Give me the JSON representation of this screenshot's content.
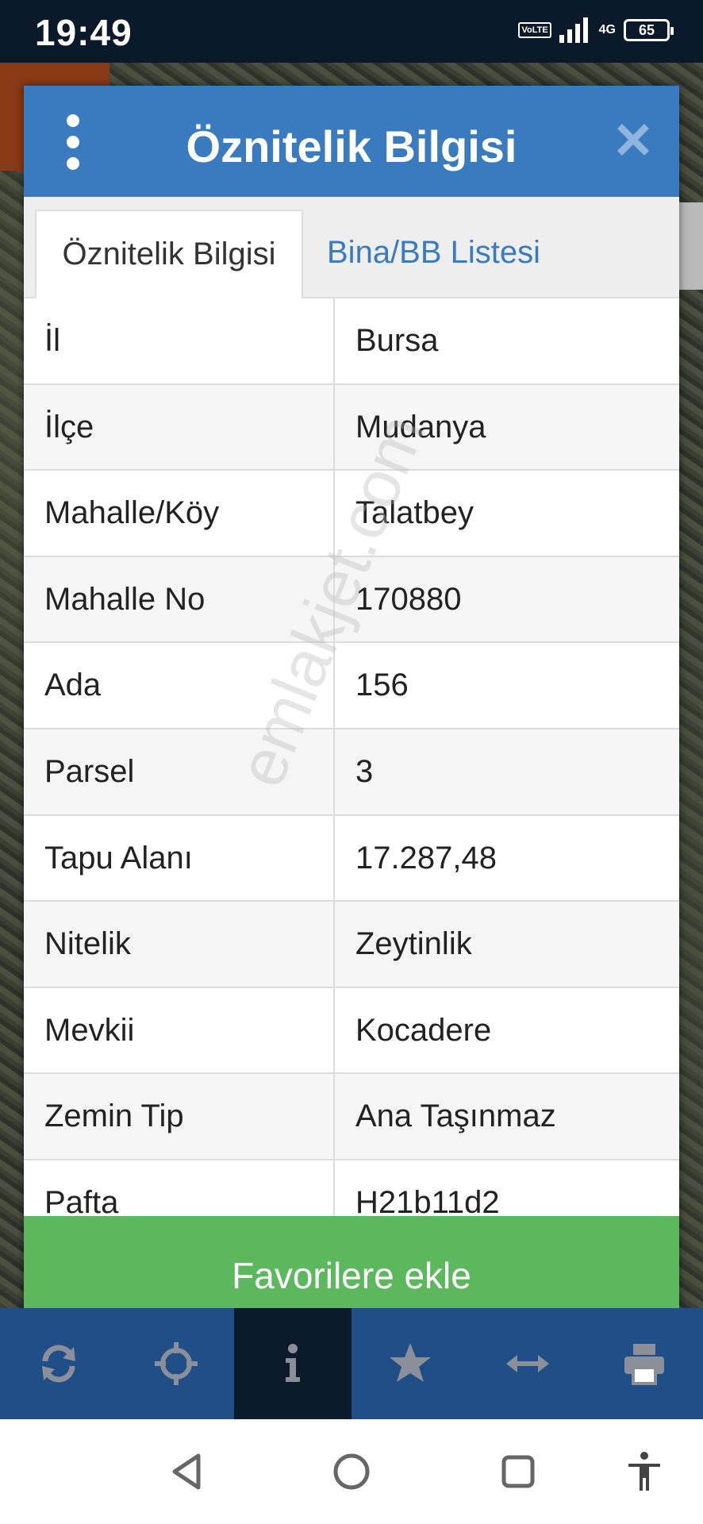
{
  "status_bar": {
    "time": "19:49",
    "volte": "VoLTE",
    "network": "4G",
    "battery": "65"
  },
  "dialog": {
    "title": "Öznitelik Bilgisi",
    "tabs": [
      {
        "label": "Öznitelik Bilgisi",
        "active": true
      },
      {
        "label": "Bina/BB Listesi",
        "active": false
      }
    ],
    "rows": [
      {
        "key": "İl",
        "value": "Bursa"
      },
      {
        "key": "İlçe",
        "value": "Mudanya"
      },
      {
        "key": "Mahalle/Köy",
        "value": "Talatbey"
      },
      {
        "key": "Mahalle No",
        "value": "170880"
      },
      {
        "key": "Ada",
        "value": "156"
      },
      {
        "key": "Parsel",
        "value": "3"
      },
      {
        "key": "Tapu Alanı",
        "value": "17.287,48"
      },
      {
        "key": "Nitelik",
        "value": "Zeytinlik"
      },
      {
        "key": "Mevkii",
        "value": "Kocadere"
      },
      {
        "key": "Zemin Tip",
        "value": "Ana Taşınmaz"
      },
      {
        "key": "Pafta",
        "value": "H21b11d2"
      }
    ],
    "favorite_button": "Favorilere ekle"
  },
  "watermark": "emlakjet.com",
  "toolbar": {
    "items": [
      {
        "icon": "refresh-icon",
        "active": false
      },
      {
        "icon": "locate-icon",
        "active": false
      },
      {
        "icon": "info-icon",
        "active": true
      },
      {
        "icon": "star-icon",
        "active": false
      },
      {
        "icon": "measure-icon",
        "active": false
      },
      {
        "icon": "print-icon",
        "active": false
      }
    ]
  },
  "navbar": {
    "items": [
      "back-icon",
      "home-icon",
      "recents-icon",
      "accessibility-icon"
    ]
  },
  "colors": {
    "header_blue": "#3a7bbf",
    "tab_link_blue": "#3a7bbf",
    "button_green": "#5cb85c",
    "toolbar_blue": "#1f4f86",
    "toolbar_icon_gray": "#8a8f99"
  }
}
